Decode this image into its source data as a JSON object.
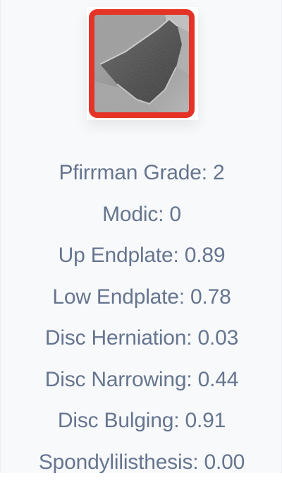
{
  "thumbnail": {
    "icon": "mri-disc-thumbnail-icon",
    "selected": true,
    "border_color": "#e63327"
  },
  "metrics": [
    {
      "label": "Pfirrman Grade: 2"
    },
    {
      "label": "Modic: 0"
    },
    {
      "label": "Up Endplate: 0.89"
    },
    {
      "label": "Low Endplate: 0.78"
    },
    {
      "label": "Disc Herniation: 0.03"
    },
    {
      "label": "Disc Narrowing: 0.44"
    },
    {
      "label": "Disc Bulging: 0.91"
    },
    {
      "label": "Spondylilisthesis: 0.00"
    }
  ],
  "colors": {
    "text": "#66758f",
    "card_background": "#f8f9fb",
    "selection_border": "#e63327"
  }
}
